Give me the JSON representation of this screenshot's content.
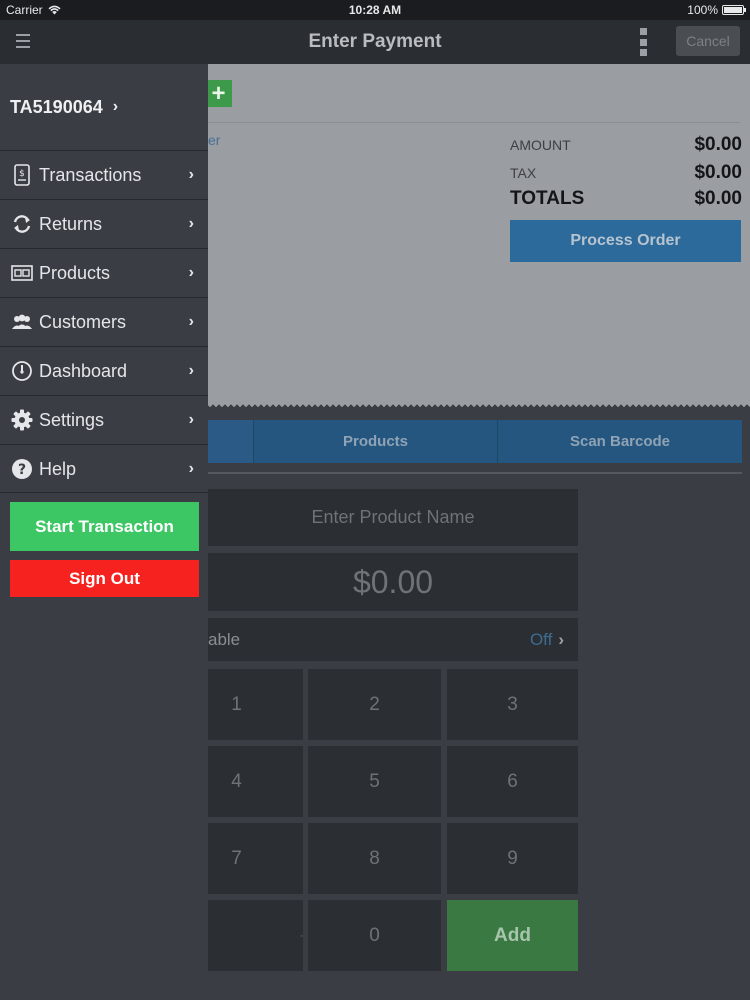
{
  "status_bar": {
    "carrier": "Carrier",
    "time": "10:28 AM",
    "battery": "100%"
  },
  "nav": {
    "title": "Enter Payment",
    "cancel": "Cancel"
  },
  "receipt": {
    "customer_link": "er",
    "amount_label": "AMOUNT",
    "amount_value": "$0.00",
    "tax_label": "TAX",
    "tax_value": "$0.00",
    "totals_label": "TOTALS",
    "totals_value": "$0.00",
    "process_button": "Process Order"
  },
  "segments": {
    "products": "Products",
    "scan": "Scan Barcode"
  },
  "entry": {
    "product_name_placeholder": "Enter Product Name",
    "price_value": "$0.00",
    "taxable_label": "able",
    "taxable_state": "Off"
  },
  "keypad": {
    "k1": "1",
    "k2": "2",
    "k3": "3",
    "k4": "4",
    "k5": "5",
    "k6": "6",
    "k7": "7",
    "k8": "8",
    "k9": "9",
    "k0": "0",
    "add": "Add"
  },
  "drawer": {
    "account_id": "TA5190064",
    "items": [
      {
        "label": "Transactions",
        "icon": "receipt-icon"
      },
      {
        "label": "Returns",
        "icon": "refresh-icon"
      },
      {
        "label": "Products",
        "icon": "products-icon"
      },
      {
        "label": "Customers",
        "icon": "people-icon"
      },
      {
        "label": "Dashboard",
        "icon": "gauge-icon"
      },
      {
        "label": "Settings",
        "icon": "gear-icon"
      },
      {
        "label": "Help",
        "icon": "help-icon"
      }
    ],
    "start_transaction": "Start Transaction",
    "sign_out": "Sign Out"
  },
  "colors": {
    "start_green": "#3cc764",
    "signout_red": "#f5221f",
    "process_blue": "#2b6a9b",
    "add_green": "#3a7a42",
    "drawer_bg": "#3a3e44"
  }
}
